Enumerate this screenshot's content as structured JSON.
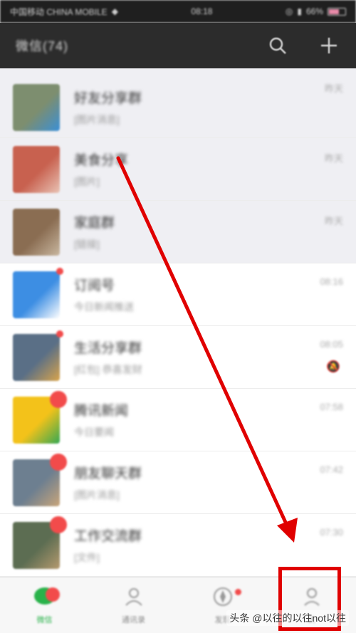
{
  "status_bar": {
    "carrier": "中国移动 CHINA MOBILE",
    "time": "08:18",
    "battery": "66%"
  },
  "header": {
    "title": "微信(74)",
    "search_icon": "search-icon",
    "add_icon": "plus-icon"
  },
  "chats": [
    {
      "title": "好友分享群",
      "subtitle": "[图片消息]",
      "time": "昨天",
      "avatar_color": "#7d8e6f",
      "avatar_accent": "#3a8fd6",
      "muted": false,
      "badge": "none",
      "row_bg": "gray"
    },
    {
      "title": "美食分享",
      "subtitle": "[图片]",
      "time": "昨天",
      "avatar_color": "#c8614f",
      "avatar_accent": "#e9c3b5",
      "muted": false,
      "badge": "none",
      "row_bg": "gray"
    },
    {
      "title": "家庭群",
      "subtitle": "[链接]",
      "time": "昨天",
      "avatar_color": "#8a6d52",
      "avatar_accent": "#c9b7a0",
      "muted": false,
      "badge": "none",
      "row_bg": "gray"
    },
    {
      "title": "订阅号",
      "subtitle": "今日新闻推送",
      "time": "08:16",
      "avatar_color": "#3d8ee3",
      "avatar_accent": "#ffffff",
      "muted": false,
      "badge": "dot",
      "row_bg": "white"
    },
    {
      "title": "生活分享群",
      "subtitle": "[红包] 恭喜发财",
      "time": "08:05",
      "avatar_color": "#5a6f86",
      "avatar_accent": "#d9a44b",
      "muted": true,
      "badge": "dot",
      "row_bg": "white"
    },
    {
      "title": "腾讯新闻",
      "subtitle": "今日要闻",
      "time": "07:58",
      "avatar_color": "#f3c21a",
      "avatar_accent": "#34a853",
      "muted": false,
      "badge": "number",
      "row_bg": "white"
    },
    {
      "title": "朋友聊天群",
      "subtitle": "[图片消息]",
      "time": "07:42",
      "avatar_color": "#6d7f90",
      "avatar_accent": "#c9a57a",
      "muted": false,
      "badge": "number",
      "row_bg": "white"
    },
    {
      "title": "工作交流群",
      "subtitle": "[文件]",
      "time": "07:30",
      "avatar_color": "#5c6d52",
      "avatar_accent": "#b59a6e",
      "muted": false,
      "badge": "number",
      "row_bg": "white"
    }
  ],
  "tabs": [
    {
      "label": "微信",
      "icon": "chat-bubble-icon",
      "active": true,
      "badge": "number"
    },
    {
      "label": "通讯录",
      "icon": "contacts-icon",
      "active": false,
      "badge": "none"
    },
    {
      "label": "发现",
      "icon": "compass-icon",
      "active": false,
      "badge": "dot"
    },
    {
      "label": "我",
      "icon": "person-icon",
      "active": false,
      "badge": "none"
    }
  ],
  "annotation": {
    "color": "#e00000",
    "arrow_icon": "arrow-down-right-icon"
  },
  "watermark": "头条 @以往的以往not以往"
}
